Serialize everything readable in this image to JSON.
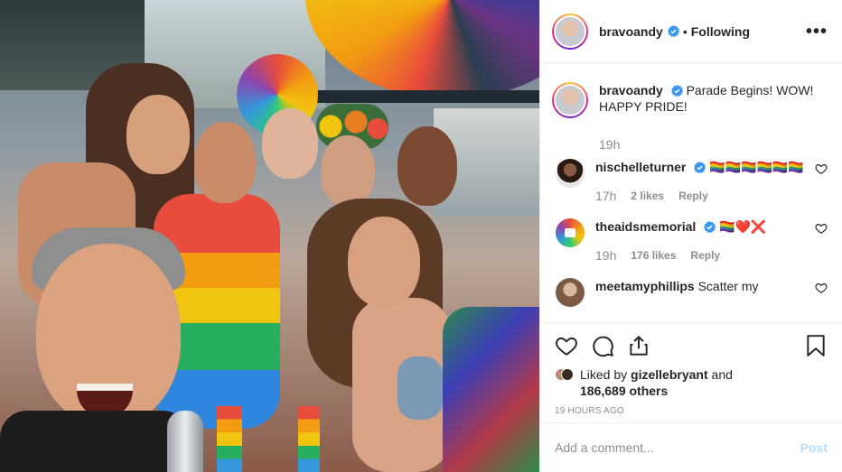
{
  "post": {
    "author": "bravoandy",
    "follow_state": "Following",
    "separator": "•",
    "more_label": "•••",
    "caption": {
      "username": "bravoandy",
      "text": "Parade Begins! WOW! HAPPY PRIDE!",
      "time": "19h"
    },
    "comments": [
      {
        "username": "nischelleturner",
        "text": "🏳️‍🌈🏳️‍🌈🏳️‍🌈🏳️‍🌈🏳️‍🌈🏳️‍🌈",
        "time": "17h",
        "likes": "2 likes",
        "reply": "Reply"
      },
      {
        "username": "theaidsmemorial",
        "text": "🏳️‍🌈❤️❌",
        "time": "19h",
        "likes": "176 likes",
        "reply": "Reply"
      },
      {
        "username": "meetamyphillips",
        "text": "Scatter my"
      }
    ],
    "likes_summary": {
      "prefix": "Liked by",
      "user": "gizellebryant",
      "connector": "and",
      "count": "186,689 others"
    },
    "timestamp": "19 HOURS AGO",
    "composer": {
      "placeholder": "Add a comment...",
      "post_label": "Post"
    }
  },
  "icons": {
    "verified": "verified-badge-icon",
    "like": "heart-icon",
    "comment": "comment-icon",
    "share": "share-icon",
    "save": "bookmark-icon"
  },
  "colors": {
    "text": "#262626",
    "muted": "#8e8e8e",
    "verified": "#3897f0",
    "post_disabled": "#b2dffc",
    "divider": "#efefef"
  }
}
